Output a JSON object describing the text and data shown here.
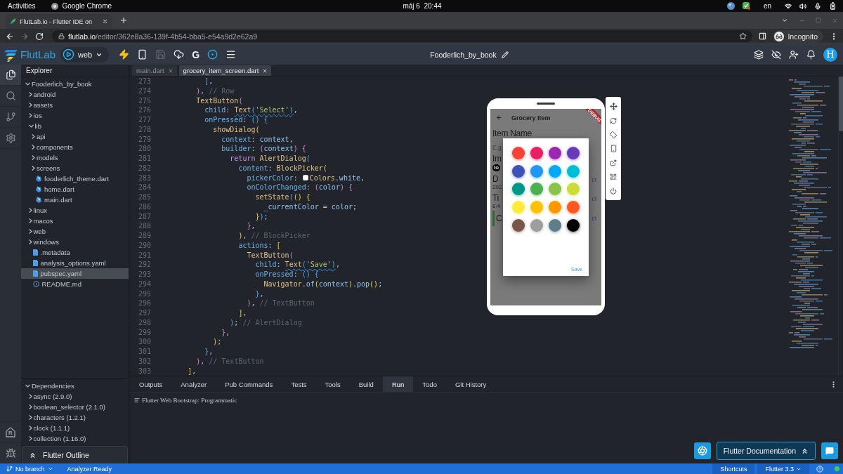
{
  "os_bar": {
    "activities": "Activities",
    "app": "Google Chrome",
    "clock": "máj 6  20:44",
    "keyboard": "en"
  },
  "browser": {
    "tab_title": "FlutLab.io - Flutter IDE on",
    "nav": [
      {
        "kind": "back",
        "disabled": false
      },
      {
        "kind": "forward",
        "disabled": true
      },
      {
        "kind": "reload",
        "disabled": false
      }
    ],
    "url_host": "flutlab.io",
    "url_path": "/editor/362e8a36-139f-4b54-bba5-e54a9d2e62a9",
    "profile": "Incognito"
  },
  "toolbar": {
    "logo": "FlutLab",
    "run_target": "web",
    "tools": [
      {
        "kind": "bolt",
        "disabled": false
      },
      {
        "kind": "device",
        "disabled": false
      },
      {
        "kind": "save",
        "disabled": true
      },
      {
        "kind": "cloud",
        "disabled": false
      },
      {
        "kind": "letter",
        "text": "G",
        "disabled": false
      },
      {
        "kind": "target",
        "disabled": false
      },
      {
        "kind": "menu",
        "disabled": false
      }
    ],
    "project": "Fooderlich_by_book",
    "avatar": "H"
  },
  "activity_bar": [
    {
      "kind": "files",
      "selected": true
    },
    {
      "kind": "search",
      "selected": false
    },
    {
      "kind": "git",
      "selected": false
    },
    {
      "kind": "settings",
      "selected": false
    }
  ],
  "activity_bottom": [
    {
      "kind": "house_letter",
      "letter": "R"
    },
    {
      "kind": "bug"
    }
  ],
  "explorer": {
    "title": "Explorer",
    "tree": [
      {
        "label": "Fooderlich_by_book",
        "kind": "folder",
        "expanded": true,
        "selected": false,
        "children": [
          {
            "label": "android",
            "kind": "folder",
            "expanded": false,
            "selected": false
          },
          {
            "label": "assets",
            "kind": "folder",
            "expanded": false,
            "selected": false
          },
          {
            "label": "ios",
            "kind": "folder",
            "expanded": false,
            "selected": false
          },
          {
            "label": "lib",
            "kind": "folder",
            "expanded": true,
            "selected": false,
            "children": [
              {
                "label": "api",
                "kind": "folder",
                "expanded": false,
                "selected": false
              },
              {
                "label": "components",
                "kind": "folder",
                "expanded": false,
                "selected": false
              },
              {
                "label": "models",
                "kind": "folder",
                "expanded": false,
                "selected": false
              },
              {
                "label": "screens",
                "kind": "folder",
                "expanded": false,
                "selected": false
              },
              {
                "label": "fooderlich_theme.dart",
                "kind": "dart",
                "selected": false
              },
              {
                "label": "home.dart",
                "kind": "dart",
                "selected": false
              },
              {
                "label": "main.dart",
                "kind": "dart",
                "selected": false
              }
            ]
          },
          {
            "label": "linux",
            "kind": "folder",
            "expanded": false,
            "selected": false
          },
          {
            "label": "macos",
            "kind": "folder",
            "expanded": false,
            "selected": false
          },
          {
            "label": "web",
            "kind": "folder",
            "expanded": false,
            "selected": false
          },
          {
            "label": "windows",
            "kind": "folder",
            "expanded": false,
            "selected": false
          },
          {
            "label": ".metadata",
            "kind": "file",
            "selected": false
          },
          {
            "label": "analysis_options.yaml",
            "kind": "file",
            "selected": false
          },
          {
            "label": "pubspec.yaml",
            "kind": "file",
            "selected": true
          },
          {
            "label": "README.md",
            "kind": "info",
            "selected": false
          }
        ]
      }
    ]
  },
  "dependencies": {
    "title": "Dependencies",
    "expanded": true,
    "items": [
      {
        "label": "async (2.9.0)",
        "expanded": false
      },
      {
        "label": "boolean_selector (2.1.0)",
        "expanded": false
      },
      {
        "label": "characters (1.2.1)",
        "expanded": false
      },
      {
        "label": "clock (1.1.1)",
        "expanded": false
      },
      {
        "label": "collection (1.16.0)",
        "expanded": false
      }
    ]
  },
  "outline": {
    "title": "Flutter Outline"
  },
  "editor": {
    "tabs": [
      {
        "label": "main.dart",
        "selected": false
      },
      {
        "label": "grocery_item_screen.dart",
        "selected": true
      }
    ],
    "lines": [
      {
        "number": "273",
        "tokens": [
          {
            "kind": "bracket3",
            "text": "          ]"
          },
          {
            "kind": "punct",
            "text": ","
          }
        ]
      },
      {
        "number": "274",
        "tokens": [
          {
            "kind": "bracket2",
            "text": "        )"
          },
          {
            "kind": "punct",
            "text": ","
          },
          {
            "kind": "comment",
            "text": " // Row"
          }
        ]
      },
      {
        "number": "275",
        "tokens": [
          {
            "kind": "type",
            "text": "        TextButton"
          },
          {
            "kind": "bracket2",
            "text": "("
          }
        ]
      },
      {
        "number": "276",
        "tokens": [
          {
            "kind": "prop",
            "text": "          child"
          },
          {
            "kind": "punct",
            "text": ": "
          },
          {
            "kind": "lint",
            "children": [
              {
                "kind": "type",
                "text": "Text"
              },
              {
                "kind": "bracket3",
                "text": "("
              },
              {
                "kind": "string",
                "text": "'Select'"
              },
              {
                "kind": "bracket3",
                "text": ")"
              }
            ]
          },
          {
            "kind": "punct",
            "text": ","
          }
        ]
      },
      {
        "number": "277",
        "tokens": [
          {
            "kind": "prop",
            "text": "          onPressed"
          },
          {
            "kind": "punct",
            "text": ": "
          },
          {
            "kind": "bracket3",
            "text": "()"
          },
          {
            "kind": "bracket3",
            "text": " {"
          }
        ]
      },
      {
        "number": "278",
        "tokens": [
          {
            "kind": "type",
            "text": "            showDialog"
          },
          {
            "kind": "bracket1",
            "text": "("
          }
        ]
      },
      {
        "number": "279",
        "tokens": [
          {
            "kind": "prop",
            "text": "              context"
          },
          {
            "kind": "punct",
            "text": ": "
          },
          {
            "kind": "var",
            "text": "context"
          },
          {
            "kind": "punct",
            "text": ","
          }
        ]
      },
      {
        "number": "280",
        "tokens": [
          {
            "kind": "prop",
            "text": "              builder"
          },
          {
            "kind": "punct",
            "text": ": "
          },
          {
            "kind": "bracket2",
            "text": "("
          },
          {
            "kind": "var",
            "text": "context"
          },
          {
            "kind": "bracket2",
            "text": ")"
          },
          {
            "kind": "bracket2",
            "text": " {"
          }
        ]
      },
      {
        "number": "281",
        "tokens": [
          {
            "kind": "keyword",
            "text": "                return"
          },
          {
            "kind": "type",
            "text": " AlertDialog"
          },
          {
            "kind": "bracket3",
            "text": "("
          }
        ]
      },
      {
        "number": "282",
        "tokens": [
          {
            "kind": "prop",
            "text": "                  content"
          },
          {
            "kind": "punct",
            "text": ": "
          },
          {
            "kind": "type",
            "text": "BlockPicker"
          },
          {
            "kind": "bracket1",
            "text": "("
          }
        ]
      },
      {
        "number": "283",
        "tokens": [
          {
            "kind": "prop",
            "text": "                    pickerColor"
          },
          {
            "kind": "punct",
            "text": ": "
          },
          {
            "kind": "swatch",
            "color": "#ffffff"
          },
          {
            "kind": "type",
            "text": "Colors"
          },
          {
            "kind": "punct",
            "text": "."
          },
          {
            "kind": "var",
            "text": "white"
          },
          {
            "kind": "punct",
            "text": ","
          }
        ]
      },
      {
        "number": "284",
        "tokens": [
          {
            "kind": "prop",
            "text": "                    onColorChanged"
          },
          {
            "kind": "punct",
            "text": ": "
          },
          {
            "kind": "bracket2",
            "text": "("
          },
          {
            "kind": "var",
            "text": "color"
          },
          {
            "kind": "bracket2",
            "text": ")"
          },
          {
            "kind": "bracket2",
            "text": " {"
          }
        ]
      },
      {
        "number": "285",
        "tokens": [
          {
            "kind": "type",
            "text": "                      setState"
          },
          {
            "kind": "bracket3",
            "text": "("
          },
          {
            "kind": "bracket1",
            "text": "()"
          },
          {
            "kind": "bracket1",
            "text": " {"
          }
        ]
      },
      {
        "number": "286",
        "tokens": [
          {
            "kind": "var",
            "text": "                        _currentColor"
          },
          {
            "kind": "punct",
            "text": " = "
          },
          {
            "kind": "var",
            "text": "color"
          },
          {
            "kind": "punct",
            "text": ";"
          }
        ]
      },
      {
        "number": "287",
        "tokens": [
          {
            "kind": "bracket1",
            "text": "                      }"
          },
          {
            "kind": "bracket3",
            "text": ")"
          },
          {
            "kind": "punct",
            "text": ";"
          }
        ]
      },
      {
        "number": "288",
        "tokens": [
          {
            "kind": "bracket2",
            "text": "                    }"
          },
          {
            "kind": "punct",
            "text": ","
          }
        ]
      },
      {
        "number": "289",
        "tokens": [
          {
            "kind": "bracket1",
            "text": "                  )"
          },
          {
            "kind": "punct",
            "text": ","
          },
          {
            "kind": "comment",
            "text": " // BlockPicker"
          }
        ]
      },
      {
        "number": "290",
        "tokens": [
          {
            "kind": "prop",
            "text": "                  actions"
          },
          {
            "kind": "punct",
            "text": ": "
          },
          {
            "kind": "bracket1",
            "text": "["
          }
        ]
      },
      {
        "number": "291",
        "tokens": [
          {
            "kind": "type",
            "text": "                    TextButton"
          },
          {
            "kind": "bracket2",
            "text": "("
          }
        ]
      },
      {
        "number": "292",
        "tokens": [
          {
            "kind": "prop",
            "text": "                      child"
          },
          {
            "kind": "punct",
            "text": ": "
          },
          {
            "kind": "lint",
            "children": [
              {
                "kind": "type",
                "text": "Text"
              },
              {
                "kind": "bracket3",
                "text": "("
              },
              {
                "kind": "string",
                "text": "'Save'"
              },
              {
                "kind": "bracket3",
                "text": ")"
              }
            ]
          },
          {
            "kind": "punct",
            "text": ","
          }
        ]
      },
      {
        "number": "293",
        "tokens": [
          {
            "kind": "prop",
            "text": "                      onPressed"
          },
          {
            "kind": "punct",
            "text": ": "
          },
          {
            "kind": "bracket3",
            "text": "()"
          },
          {
            "kind": "bracket3",
            "text": " {"
          }
        ]
      },
      {
        "number": "294",
        "tokens": [
          {
            "kind": "type",
            "text": "                        Navigator"
          },
          {
            "kind": "punct",
            "text": "."
          },
          {
            "kind": "var",
            "text": "of"
          },
          {
            "kind": "bracket1",
            "text": "("
          },
          {
            "kind": "var",
            "text": "context"
          },
          {
            "kind": "bracket1",
            "text": ")"
          },
          {
            "kind": "punct",
            "text": "."
          },
          {
            "kind": "var",
            "text": "pop"
          },
          {
            "kind": "bracket1",
            "text": "()"
          },
          {
            "kind": "punct",
            "text": ";"
          }
        ]
      },
      {
        "number": "295",
        "tokens": [
          {
            "kind": "bracket3",
            "text": "                      }"
          },
          {
            "kind": "punct",
            "text": ","
          }
        ]
      },
      {
        "number": "296",
        "tokens": [
          {
            "kind": "bracket2",
            "text": "                    )"
          },
          {
            "kind": "punct",
            "text": ","
          },
          {
            "kind": "comment",
            "text": " // TextButton"
          }
        ]
      },
      {
        "number": "297",
        "tokens": [
          {
            "kind": "bracket1",
            "text": "                  ]"
          },
          {
            "kind": "punct",
            "text": ","
          }
        ]
      },
      {
        "number": "298",
        "tokens": [
          {
            "kind": "bracket3",
            "text": "                )"
          },
          {
            "kind": "punct",
            "text": ";"
          },
          {
            "kind": "comment",
            "text": " // AlertDialog"
          }
        ]
      },
      {
        "number": "299",
        "tokens": [
          {
            "kind": "bracket2",
            "text": "              }"
          },
          {
            "kind": "punct",
            "text": ","
          }
        ]
      },
      {
        "number": "300",
        "tokens": [
          {
            "kind": "bracket1",
            "text": "            )"
          },
          {
            "kind": "punct",
            "text": ";"
          }
        ]
      },
      {
        "number": "301",
        "tokens": [
          {
            "kind": "bracket3",
            "text": "          }"
          },
          {
            "kind": "punct",
            "text": ","
          }
        ]
      },
      {
        "number": "302",
        "tokens": [
          {
            "kind": "bracket2",
            "text": "        )"
          },
          {
            "kind": "punct",
            "text": ","
          },
          {
            "kind": "comment",
            "text": " // TextButton"
          }
        ]
      },
      {
        "number": "303",
        "tokens": [
          {
            "kind": "bracket1",
            "text": "      ]"
          },
          {
            "kind": "punct",
            "text": ","
          }
        ]
      }
    ]
  },
  "preview": {
    "title": "Grocery Item",
    "banner": "DEBUG",
    "form": [
      {
        "kind": "heading",
        "text": "Item Name"
      },
      {
        "kind": "field",
        "placeholder": "E.g"
      },
      {
        "kind": "heading",
        "text": "Im"
      },
      {
        "kind": "chip",
        "text": "lo"
      },
      {
        "kind": "heading",
        "text": "D",
        "trailing": "ct"
      },
      {
        "kind": "caption",
        "text": "202"
      },
      {
        "kind": "heading",
        "text": "Ti",
        "trailing": "ct"
      },
      {
        "kind": "caption",
        "text": "8:4"
      },
      {
        "kind": "color_row",
        "text": "C",
        "color": "#2e6b30",
        "trailing": "ct"
      }
    ],
    "palette": [
      {
        "color": "#f44336"
      },
      {
        "color": "#e91e63"
      },
      {
        "color": "#9c27b0"
      },
      {
        "color": "#673ab7"
      },
      {
        "color": "#3f51b5"
      },
      {
        "color": "#2196f3"
      },
      {
        "color": "#03a9f4"
      },
      {
        "color": "#00bcd4"
      },
      {
        "color": "#009688"
      },
      {
        "color": "#4caf50"
      },
      {
        "color": "#8bc34a"
      },
      {
        "color": "#cddc39"
      },
      {
        "color": "#ffeb3b"
      },
      {
        "color": "#ffc107"
      },
      {
        "color": "#ff9800"
      },
      {
        "color": "#ff5722"
      },
      {
        "color": "#795548"
      },
      {
        "color": "#9e9e9e"
      },
      {
        "color": "#607d8b"
      },
      {
        "color": "#000000"
      }
    ],
    "action": "Save"
  },
  "panel": {
    "tabs": [
      {
        "label": "Outputs",
        "selected": false
      },
      {
        "label": "Analyzer",
        "selected": false
      },
      {
        "label": "Pub Commands",
        "selected": false
      },
      {
        "label": "Tests",
        "selected": false
      },
      {
        "label": "Tools",
        "selected": false
      },
      {
        "label": "Build",
        "selected": false
      },
      {
        "label": "Run",
        "selected": true
      },
      {
        "label": "Todo",
        "selected": false
      },
      {
        "label": "Git History",
        "selected": false
      }
    ],
    "log": "Flutter Web Bootstrap: Programmatic",
    "docs_button": "Flutter Documentation"
  },
  "status_bar": {
    "branch": "No branch",
    "analyzer": "Analyzer Ready",
    "shortcuts": "Shortcuts",
    "sdk": "Flutter 3.3"
  }
}
